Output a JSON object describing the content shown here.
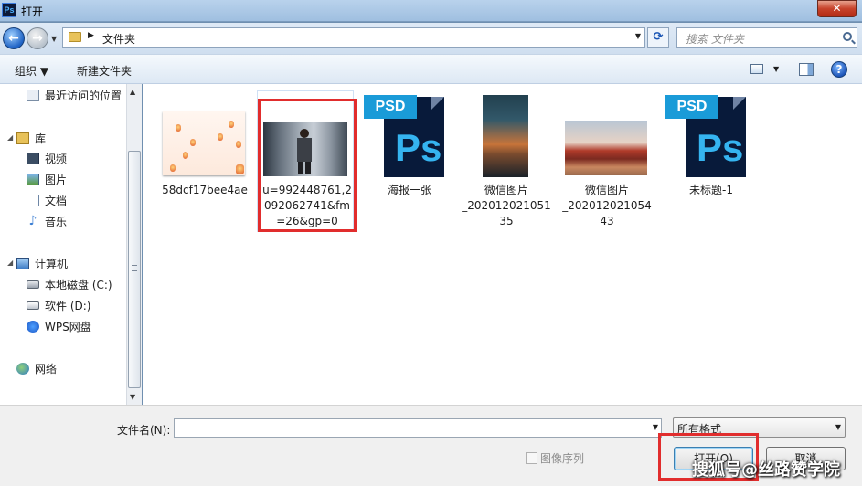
{
  "window": {
    "title": "打开",
    "app_badge": "Ps",
    "close_label": "✕"
  },
  "address": {
    "path": "文件夹",
    "search_placeholder": "搜索 文件夹"
  },
  "toolbar": {
    "organize": "组织 ▼",
    "new_folder": "新建文件夹",
    "help": "?"
  },
  "sidebar": {
    "recent": "最近访问的位置",
    "libraries": "库",
    "video": "视频",
    "pictures": "图片",
    "documents": "文档",
    "music": "音乐",
    "computer": "计算机",
    "local_disk": "本地磁盘 (C:)",
    "software": "软件 (D:)",
    "wps": "WPS网盘",
    "network": "网络"
  },
  "files": [
    {
      "label_lines": [
        "58dcf17bee4ae"
      ]
    },
    {
      "label_lines": [
        "u=992448761,2",
        "092062741&fm",
        "=26&gp=0"
      ]
    },
    {
      "label_lines": [
        "海报一张"
      ],
      "badge": "PSD",
      "glyph": "Ps"
    },
    {
      "label_lines": [
        "微信图片",
        "_202012021051",
        "35"
      ]
    },
    {
      "label_lines": [
        "微信图片",
        "_202012021054",
        "43"
      ]
    },
    {
      "label_lines": [
        "未标题-1"
      ],
      "badge": "PSD",
      "glyph": "Ps"
    }
  ],
  "bottom": {
    "filename_label": "文件名(N):",
    "filename_value": "",
    "format": "所有格式",
    "image_sequence": "图像序列",
    "open": "打开(O)",
    "cancel": "取消"
  },
  "watermark": "搜狐号@丝路赞学院"
}
